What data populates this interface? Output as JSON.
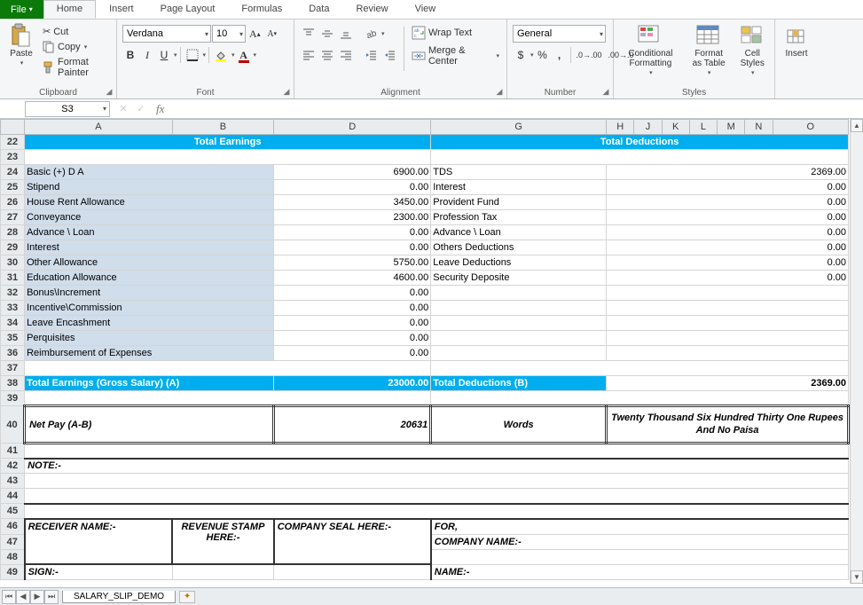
{
  "tabs": {
    "file": "File",
    "home": "Home",
    "insert": "Insert",
    "page_layout": "Page Layout",
    "formulas": "Formulas",
    "data": "Data",
    "review": "Review",
    "view": "View"
  },
  "clipboard": {
    "paste": "Paste",
    "cut": "Cut",
    "copy": "Copy",
    "painter": "Format Painter",
    "label": "Clipboard"
  },
  "font": {
    "name": "Verdana",
    "size": "10",
    "label": "Font"
  },
  "alignment": {
    "wrap": "Wrap Text",
    "merge": "Merge & Center",
    "label": "Alignment"
  },
  "number": {
    "format": "General",
    "label": "Number"
  },
  "styles": {
    "cond": "Conditional Formatting",
    "table": "Format as Table",
    "cell": "Cell Styles",
    "label": "Styles"
  },
  "cells": {
    "insert": "Insert"
  },
  "namebox": "S3",
  "fx": "fx",
  "cols": [
    "A",
    "B",
    "D",
    "G",
    "H",
    "J",
    "K",
    "L",
    "M",
    "N",
    "O"
  ],
  "hdr": {
    "earnings": "Total Earnings",
    "deductions": "Total Deductions"
  },
  "earnings": [
    {
      "label": "Basic (+) D A",
      "value": "6900.00"
    },
    {
      "label": "Stipend",
      "value": "0.00"
    },
    {
      "label": "House Rent Allowance",
      "value": "3450.00"
    },
    {
      "label": "Conveyance",
      "value": "2300.00"
    },
    {
      "label": "Advance \\ Loan",
      "value": "0.00"
    },
    {
      "label": "Interest",
      "value": "0.00"
    },
    {
      "label": "Other Allowance",
      "value": "5750.00"
    },
    {
      "label": "Education Allowance",
      "value": "4600.00"
    },
    {
      "label": "Bonus\\Increment",
      "value": "0.00"
    },
    {
      "label": "Incentive\\Commission",
      "value": "0.00"
    },
    {
      "label": "Leave Encashment",
      "value": "0.00"
    },
    {
      "label": "Perquisites",
      "value": "0.00"
    },
    {
      "label": "Reimbursement of Expenses",
      "value": "0.00"
    }
  ],
  "deductions": [
    {
      "label": "TDS",
      "value": "2369.00"
    },
    {
      "label": "Interest",
      "value": "0.00"
    },
    {
      "label": "Provident Fund",
      "value": "0.00"
    },
    {
      "label": "Profession Tax",
      "value": "0.00"
    },
    {
      "label": "Advance \\ Loan",
      "value": "0.00"
    },
    {
      "label": "Others Deductions",
      "value": "0.00"
    },
    {
      "label": "Leave Deductions",
      "value": "0.00"
    },
    {
      "label": "Security Deposite",
      "value": "0.00"
    }
  ],
  "totals": {
    "earn_label": "Total Earnings (Gross Salary) (A)",
    "earn_value": "23000.00",
    "ded_label": "Total Deductions (B)",
    "ded_value": "2369.00"
  },
  "netpay": {
    "label": "Net Pay (A-B)",
    "value": "20631",
    "words_label": "Words",
    "words": "Twenty Thousand Six Hundred Thirty One Rupees And No Paisa"
  },
  "note": "NOTE:-",
  "sig": {
    "receiver": "RECEIVER NAME:-",
    "stamp": "REVENUE STAMP HERE:-",
    "seal": "COMPANY SEAL HERE:-",
    "for": "FOR,",
    "company": "COMPANY NAME:-",
    "sign": "SIGN:-",
    "name": "NAME:-"
  },
  "sheet_tab": "SALARY_SLIP_DEMO"
}
